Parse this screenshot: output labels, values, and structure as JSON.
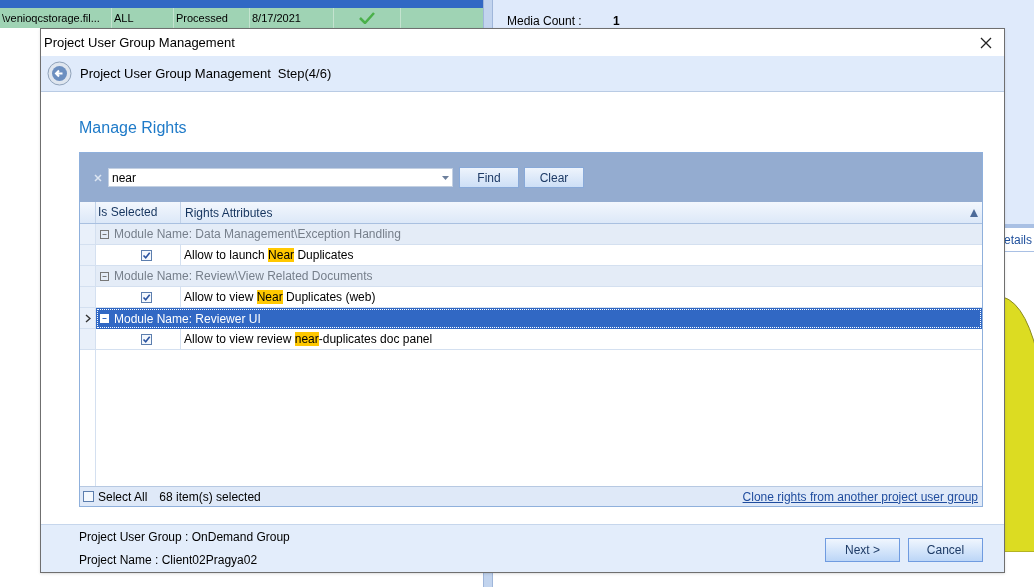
{
  "background": {
    "files_table": {
      "row": {
        "cells": [
          "\\venioqcstorage.fil...",
          "ALL",
          "Processed",
          "8/17/2021"
        ],
        "done": true
      }
    },
    "summary": [
      {
        "label": "Media Count :",
        "value": "1"
      }
    ],
    "tab_fragment": "etails"
  },
  "dialog": {
    "title": "Project User Group Management",
    "header": {
      "title": "Project User Group Management",
      "step": "Step(4/6)"
    },
    "section_title": "Manage Rights",
    "search": {
      "value": "near",
      "find_button": "Find",
      "clear_button": "Clear"
    },
    "grid": {
      "columns": [
        "Is Selected",
        "Rights Attributes"
      ],
      "groups": [
        {
          "label": "Module Name:",
          "name": "Data Management\\Exception Handling",
          "expanded": true,
          "selected": false,
          "items": [
            {
              "checked": true,
              "before": "Allow to launch ",
              "match": "Near",
              "after": " Duplicates"
            }
          ]
        },
        {
          "label": "Module Name:",
          "name": "Review\\View Related Documents",
          "expanded": true,
          "selected": false,
          "items": [
            {
              "checked": true,
              "before": "Allow to view ",
              "match": "Near",
              "after": " Duplicates (web)"
            }
          ]
        },
        {
          "label": "Module Name:",
          "name": "Reviewer UI",
          "expanded": true,
          "selected": true,
          "items": [
            {
              "checked": true,
              "before": "Allow to view review ",
              "match": "near",
              "after": "-duplicates doc panel"
            }
          ]
        }
      ]
    },
    "select_all": {
      "label": "Select All",
      "checked": false
    },
    "selected_count": "68 item(s) selected",
    "clone_link": "Clone rights from another project user group",
    "footer": {
      "info": [
        "Project User Group : OnDemand Group",
        "Project Name : Client02Pragya02"
      ],
      "buttons": [
        "Next >",
        "Cancel"
      ]
    }
  }
}
